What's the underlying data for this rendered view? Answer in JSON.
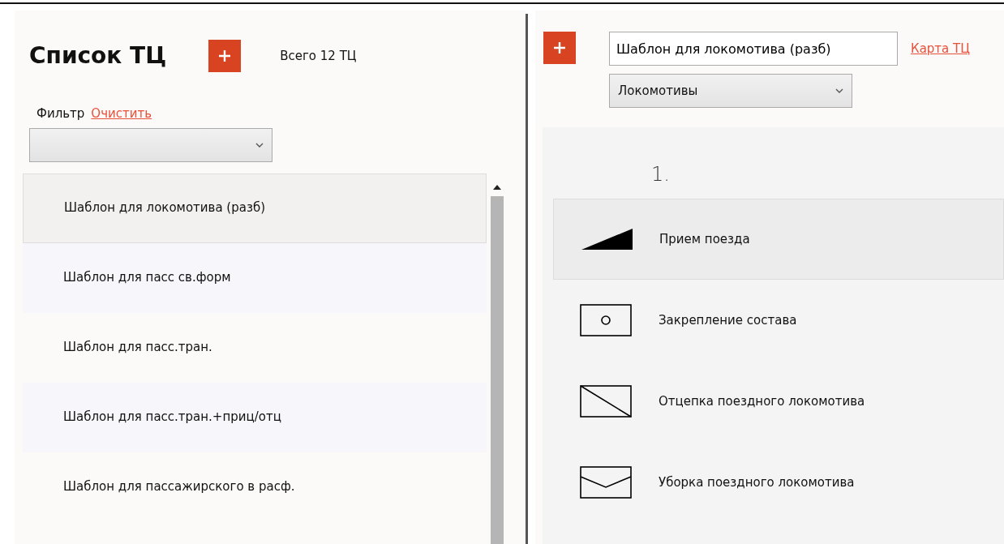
{
  "left_panel": {
    "title": "Список ТЦ",
    "total": "Всего 12 ТЦ",
    "filter_label": "Фильтр",
    "clear_link": "Очистить",
    "items": [
      {
        "label": "Шаблон для локомотива (разб)",
        "selected": true
      },
      {
        "label": "Шаблон для пасс св.форм",
        "selected": false
      },
      {
        "label": "Шаблон для пасс.тран.",
        "selected": false
      },
      {
        "label": "Шаблон для пасс.тран.+приц/отц",
        "selected": false
      },
      {
        "label": "Шаблон для пассажирского в расф.",
        "selected": false
      }
    ]
  },
  "right_panel": {
    "name_value": "Шаблон для локомотива (разб)",
    "map_link": "Карта ТЦ",
    "type_value": "Локомотивы",
    "group_number": "1.",
    "steps": [
      {
        "kind": "arrival",
        "label": "Прием поезда",
        "selected": true
      },
      {
        "kind": "fixing",
        "label": "Закрепление состава",
        "selected": false
      },
      {
        "kind": "uncoupling",
        "label": "Отцепка поездного локомотива",
        "selected": false
      },
      {
        "kind": "cleaning",
        "label": "Уборка поездного локомотива",
        "selected": false
      }
    ]
  }
}
